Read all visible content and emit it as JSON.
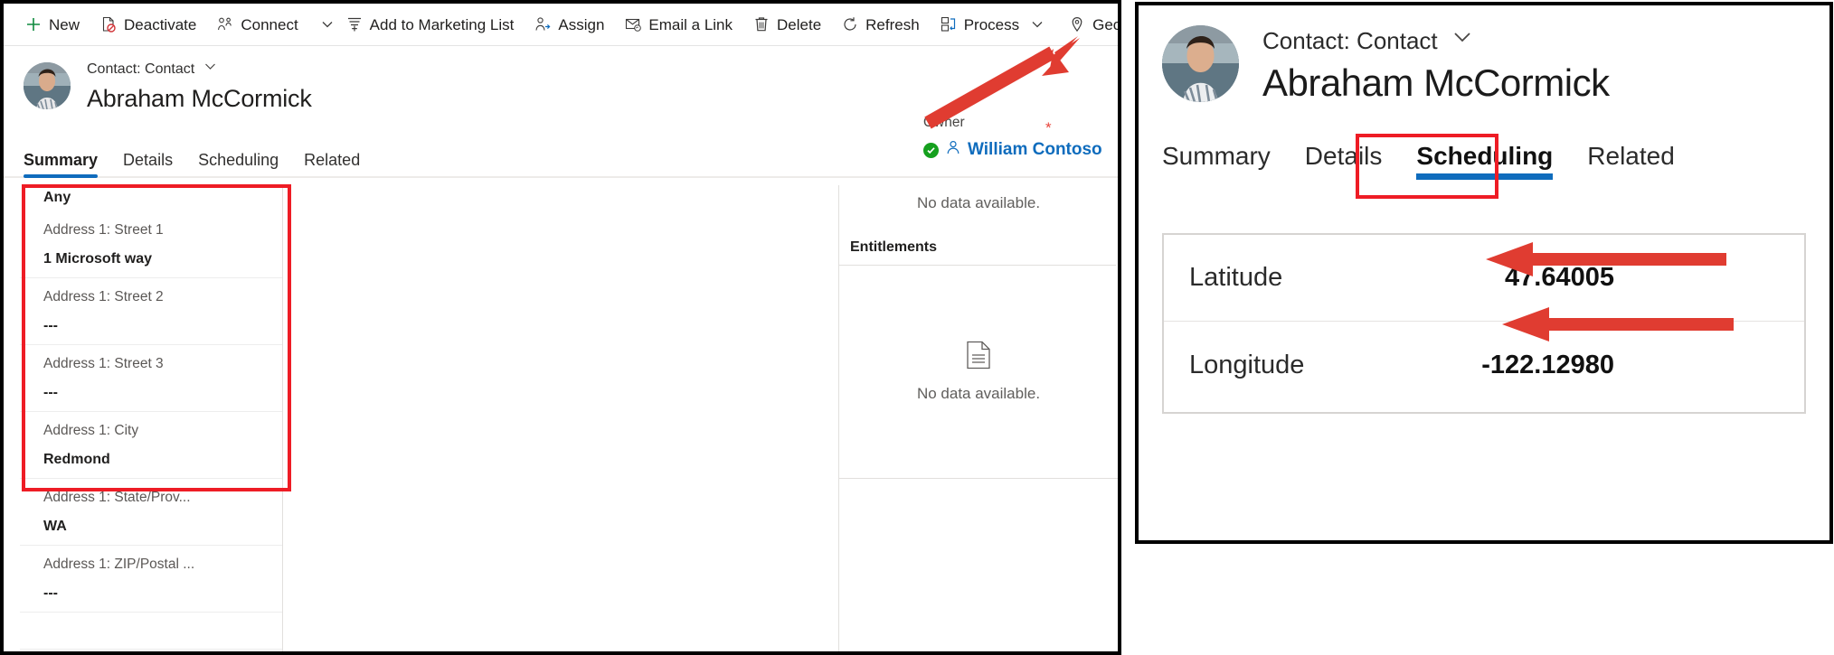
{
  "colors": {
    "accent": "#0f6cbd",
    "highlight": "#ee1c25",
    "arrow": "#e03c31",
    "link": "#0f6cbd",
    "success": "#15a01e",
    "required": "#e8453c"
  },
  "left_panel": {
    "command_bar": {
      "buttons": [
        {
          "label": "New",
          "icon": "plus-icon"
        },
        {
          "label": "Deactivate",
          "icon": "deactivate-icon"
        },
        {
          "label": "Connect",
          "icon": "connect-icon"
        },
        {
          "label": "Add to Marketing List",
          "icon": "marketing-list-icon"
        },
        {
          "label": "Assign",
          "icon": "assign-icon"
        },
        {
          "label": "Email a Link",
          "icon": "email-link-icon"
        },
        {
          "label": "Delete",
          "icon": "trash-icon"
        },
        {
          "label": "Refresh",
          "icon": "refresh-icon"
        },
        {
          "label": "Process",
          "icon": "process-icon"
        },
        {
          "label": "Geo Code",
          "icon": "map-pin-icon"
        }
      ]
    },
    "record": {
      "entity_label": "Contact: Contact",
      "name": "Abraham McCormick",
      "owner_label": "Owner",
      "owner_name": "William Contoso",
      "required_marker": "*"
    },
    "tabs": [
      {
        "label": "Summary",
        "active": true
      },
      {
        "label": "Details",
        "active": false
      },
      {
        "label": "Scheduling",
        "active": false
      },
      {
        "label": "Related",
        "active": false
      }
    ],
    "fields": {
      "top_value": "Any",
      "rows": [
        {
          "label": "Address 1: Street 1",
          "value": "1 Microsoft way"
        },
        {
          "label": "Address 1: Street 2",
          "value": "---"
        },
        {
          "label": "Address 1: Street 3",
          "value": "---"
        },
        {
          "label": "Address 1: City",
          "value": "Redmond"
        },
        {
          "label": "Address 1: State/Prov...",
          "value": "WA"
        },
        {
          "label": "Address 1: ZIP/Postal ...",
          "value": "---"
        }
      ]
    },
    "right_column": {
      "top_message": "No data available.",
      "entitlements_heading": "Entitlements",
      "empty_message": "No data available.",
      "empty_icon": "document-icon"
    }
  },
  "right_panel": {
    "record": {
      "entity_label": "Contact: Contact",
      "name": "Abraham McCormick"
    },
    "tabs": [
      {
        "label": "Summary",
        "active": false
      },
      {
        "label": "Details",
        "active": false
      },
      {
        "label": "Scheduling",
        "active": true
      },
      {
        "label": "Related",
        "active": false
      }
    ],
    "geo_card": {
      "rows": [
        {
          "label": "Latitude",
          "value": "47.64005"
        },
        {
          "label": "Longitude",
          "value": "-122.12980"
        }
      ]
    }
  }
}
